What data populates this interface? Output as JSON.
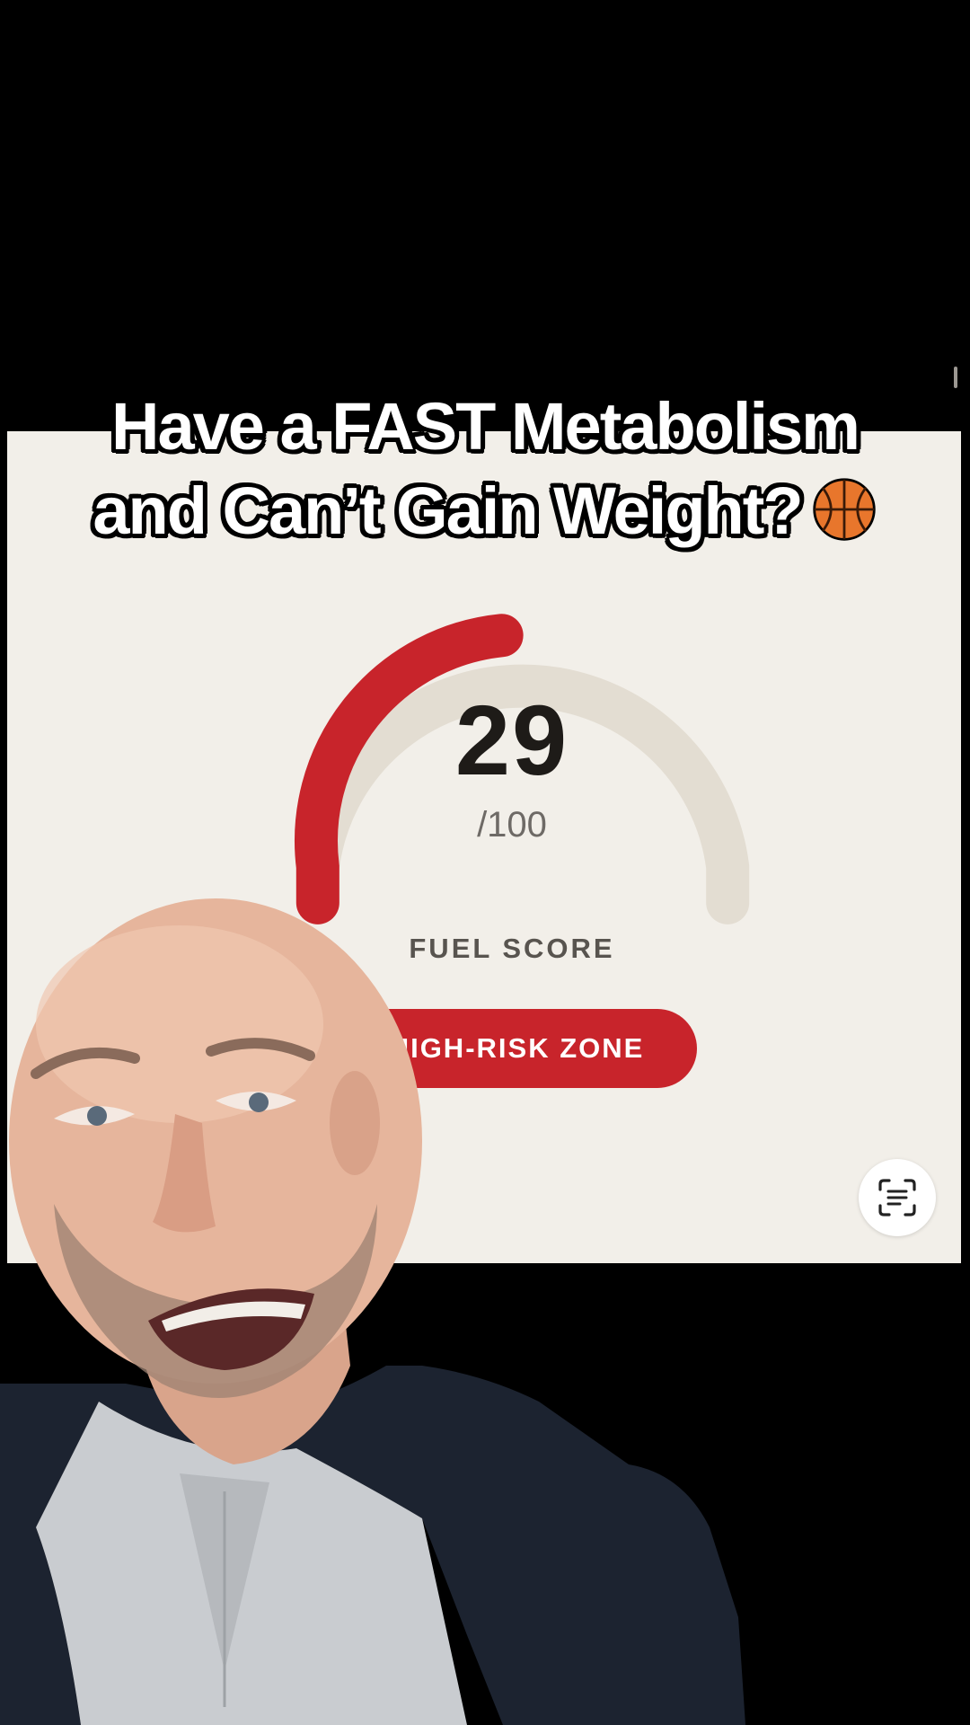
{
  "caption": {
    "line1": "Have a FAST Metabolism",
    "line2": "and Can’t Gain Weight?",
    "emoji_icon": "basketball-icon"
  },
  "gauge": {
    "score": "29",
    "max": "/100",
    "score_fraction": 0.29,
    "label": "FUEL SCORE",
    "status": "HIGH-RISK ZONE",
    "colors": {
      "fill": "#c8242b",
      "track": "#e3ddd2",
      "panel": "#f2efe9"
    }
  },
  "controls": {
    "scan_icon": "scan-text-icon"
  },
  "presenter": {
    "icon": "presenter-person"
  }
}
